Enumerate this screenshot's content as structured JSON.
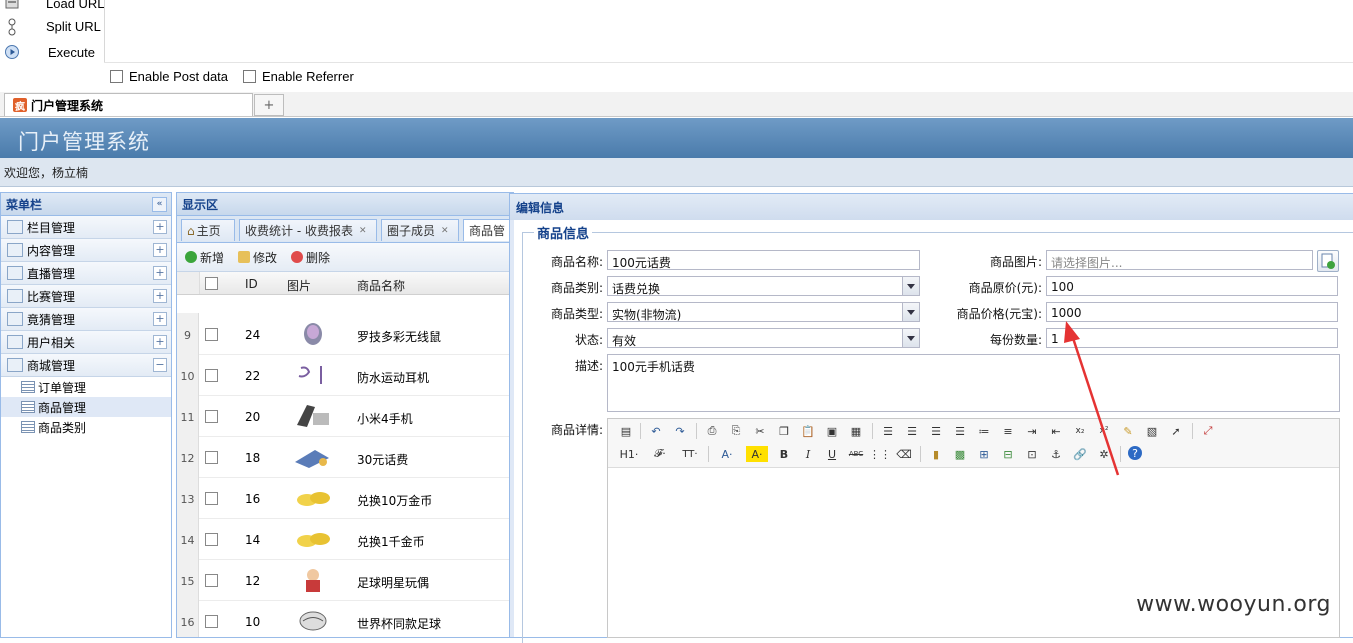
{
  "hackbar": {
    "items": [
      {
        "label": "Load URL",
        "icon": "load-url-icon"
      },
      {
        "label": "Split URL",
        "icon": "split-url-icon"
      },
      {
        "label": "Execute",
        "icon": "execute-icon"
      }
    ],
    "enable_post": "Enable Post data",
    "enable_referrer": "Enable Referrer"
  },
  "browser_tab": {
    "title": "门户管理系统",
    "new_tab": "+"
  },
  "app": {
    "title": "门户管理系统",
    "welcome": "欢迎您，杨立楠",
    "accent": "#4a7bab"
  },
  "menu": {
    "title": "菜单栏",
    "groups": [
      "栏目管理",
      "内容管理",
      "直播管理",
      "比赛管理",
      "竟猜管理",
      "用户相关",
      "商城管理"
    ],
    "sub_items": [
      "订单管理",
      "商品管理",
      "商品类别"
    ]
  },
  "display": {
    "title": "显示区",
    "tabs": [
      "主页",
      "收费统计 - 收费报表",
      "圈子成员",
      "商品管"
    ],
    "toolbar": {
      "add": "新增",
      "edit": "修改",
      "delete": "删除"
    },
    "columns": {
      "id": "ID",
      "image": "图片",
      "name": "商品名称"
    },
    "rows": [
      {
        "num": "9",
        "id": "24",
        "name": "罗技多彩无线鼠"
      },
      {
        "num": "10",
        "id": "22",
        "name": "防水运动耳机"
      },
      {
        "num": "11",
        "id": "20",
        "name": "小米4手机"
      },
      {
        "num": "12",
        "id": "18",
        "name": "30元话费"
      },
      {
        "num": "13",
        "id": "16",
        "name": "兑换10万金币"
      },
      {
        "num": "14",
        "id": "14",
        "name": "兑换1千金币"
      },
      {
        "num": "15",
        "id": "12",
        "name": "足球明星玩偶"
      },
      {
        "num": "16",
        "id": "10",
        "name": "世界杯同款足球"
      }
    ]
  },
  "edit": {
    "title": "编辑信息",
    "section": "商品信息",
    "fields": {
      "name_label": "商品名称:",
      "name_value": "100元话费",
      "image_label": "商品图片:",
      "image_placeholder": "请选择图片...",
      "category_label": "商品类别:",
      "category_value": "话费兑换",
      "orig_price_label": "商品原价(元):",
      "orig_price_value": "100",
      "type_label": "商品类型:",
      "type_value": "实物(非物流)",
      "price_label": "商品价格(元宝):",
      "price_value": "1000",
      "status_label": "状态:",
      "status_value": "有效",
      "qty_label": "每份数量:",
      "qty_value": "1",
      "desc_label": "描述:",
      "desc_value": "100元手机话费",
      "detail_label": "商品详情:"
    },
    "editor_buttons_row2": {
      "h1": "H1·",
      "font": "𝓕·",
      "size": "TT·",
      "color": "A·",
      "bg": "A·",
      "bold": "B",
      "italic": "I",
      "underline": "U",
      "strike": "ABC"
    }
  },
  "annotation_color": "#e53333",
  "watermark": "www.wooyun.org"
}
